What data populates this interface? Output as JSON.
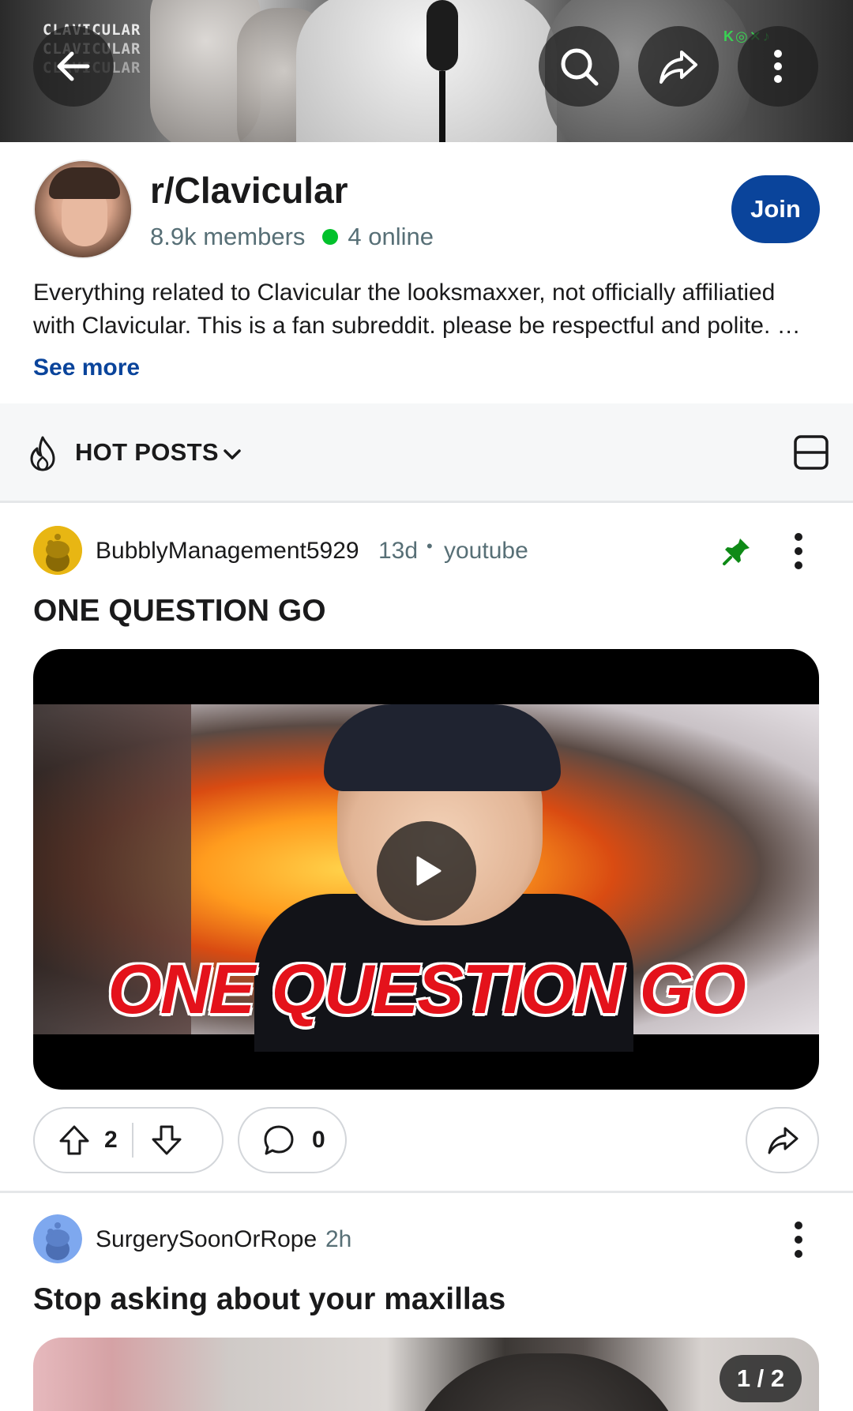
{
  "banner": {
    "brand_lines": [
      "CLAVICULAR",
      "CLAVICULAR",
      "CLAVICULAR"
    ],
    "socials": "K◎✕♪"
  },
  "toolbar": {
    "back_icon": "arrow-left-icon",
    "search_icon": "search-icon",
    "share_icon": "share-icon",
    "more_icon": "more-vertical-icon"
  },
  "community": {
    "name": "r/Clavicular",
    "members": "8.9k members",
    "online": "4 online",
    "join_label": "Join",
    "description_lines": [
      "Everything related to Clavicular the looksmaxxer, not officially affiliatied",
      "with Clavicular. This is a fan subreddit. please be respectful and polite. …"
    ],
    "see_more": "See more",
    "online_color": "#01c12b",
    "accent_color": "#0a449b"
  },
  "sort": {
    "label": "HOT POSTS",
    "icon": "flame-icon",
    "layout_icon": "card-layout-icon"
  },
  "posts": [
    {
      "author": "BubblyManagement5929",
      "time": "13d",
      "separator": "•",
      "source": "youtube",
      "pinned": true,
      "title": "ONE QUESTION GO",
      "video_text": "ONE QUESTION GO",
      "upvotes": "2",
      "comments": "0",
      "pin_color": "#0e8a16"
    },
    {
      "author": "SurgerySoonOrRope",
      "time": "2h",
      "title": "Stop asking about your maxillas",
      "gallery_counter": "1 / 2"
    }
  ]
}
